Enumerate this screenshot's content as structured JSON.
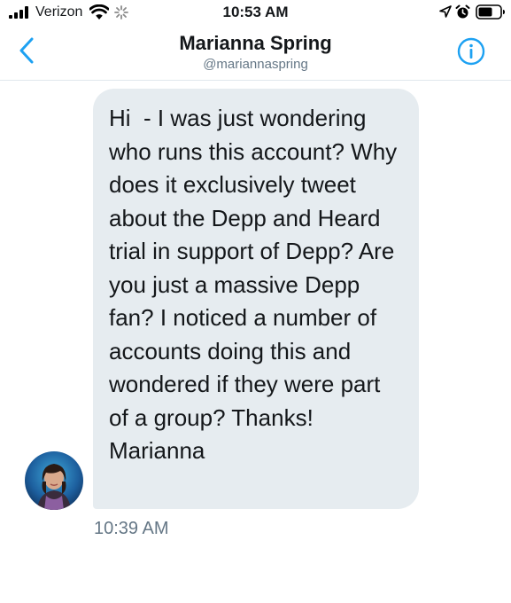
{
  "status_bar": {
    "carrier": "Verizon",
    "time": "10:53 AM",
    "icons": [
      "signal-icon",
      "wifi-icon",
      "activity-spinner-icon",
      "location-arrow-icon",
      "alarm-clock-icon",
      "battery-icon"
    ]
  },
  "header": {
    "name": "Marianna Spring",
    "handle": "@mariannaspring",
    "back_icon": "chevron-left-icon",
    "info_icon": "info-circle-icon",
    "accent_color": "#1da1f2"
  },
  "conversation": {
    "message": {
      "text": "Hi  - I was just wondering who runs this account? Why does it exclusively tweet about the Depp and Heard trial in support of Depp? Are you just a massive Depp fan? I noticed a number of accounts doing this and wondered if they were part of a group? Thanks! Marianna",
      "timestamp": "10:39 AM",
      "bubble_color": "#e6ecf0"
    }
  }
}
